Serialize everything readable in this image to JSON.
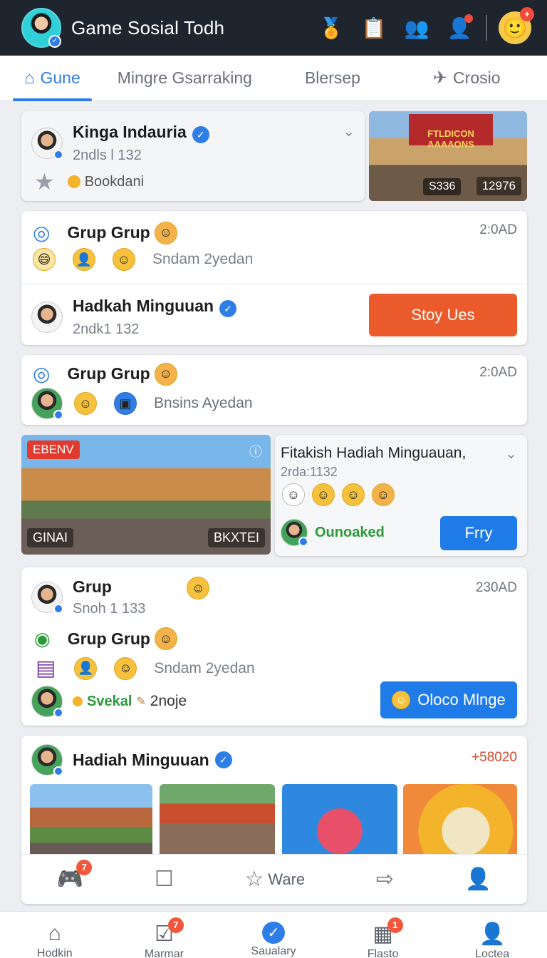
{
  "app": {
    "title": "Game Sosial Todh"
  },
  "header": {
    "icons": [
      "trophy-icon",
      "clipboard-icon",
      "friends-icon",
      "user-add-icon",
      "smiley-badge-icon"
    ],
    "plus_badge": "+"
  },
  "tabs": [
    {
      "label": "Gune",
      "active": true
    },
    {
      "label": "Mingre Gsarraking"
    },
    {
      "label": "Blersep"
    },
    {
      "label": "Crosio"
    }
  ],
  "card1": {
    "name": "Kinga Indauria",
    "sub": "2ndls l 132",
    "meta": "Bookdani",
    "photo_title": "FTLDICON AAAAONS",
    "photo_left": "S336",
    "photo_right": "12976"
  },
  "card2": {
    "title": "Grup Grup",
    "time": "2:0AD",
    "members_text": "Sndam 2yedan",
    "name2": "Hadkah Minguuan",
    "sub2": "2ndk1 132",
    "button": "Stoy Ues"
  },
  "card3": {
    "title": "Grup Grup",
    "time": "2:0AD",
    "members_text": "Bnsins Ayedan"
  },
  "card4": {
    "photo_tag": "EBENV",
    "photo_left": "GINAI",
    "photo_right": "BKXTEI",
    "title": "Fitakish Hadiah Minguauan,",
    "sub": "2rda:1132",
    "status": "Ounoaked",
    "button": "Frry"
  },
  "card5": {
    "name": "Grup",
    "sub": "Snoh 1 133",
    "time": "230AD",
    "group": "Grup Grup",
    "members_text": "Sndam 2yedan",
    "status_green": "Svekal",
    "status_text": "2noje",
    "button": "Oloco Mlnge"
  },
  "card6": {
    "name": "Hadiah Minguuan",
    "delta": "+58020"
  },
  "card_toolbar": {
    "label": "Ware",
    "badge": "7"
  },
  "bottom_nav": [
    {
      "label": "Hodkin",
      "badge": ""
    },
    {
      "label": "Marmar",
      "badge": "7"
    },
    {
      "label": "Saualary",
      "badge": ""
    },
    {
      "label": "Flasto",
      "badge": "1"
    },
    {
      "label": "Loctea",
      "badge": ""
    }
  ]
}
